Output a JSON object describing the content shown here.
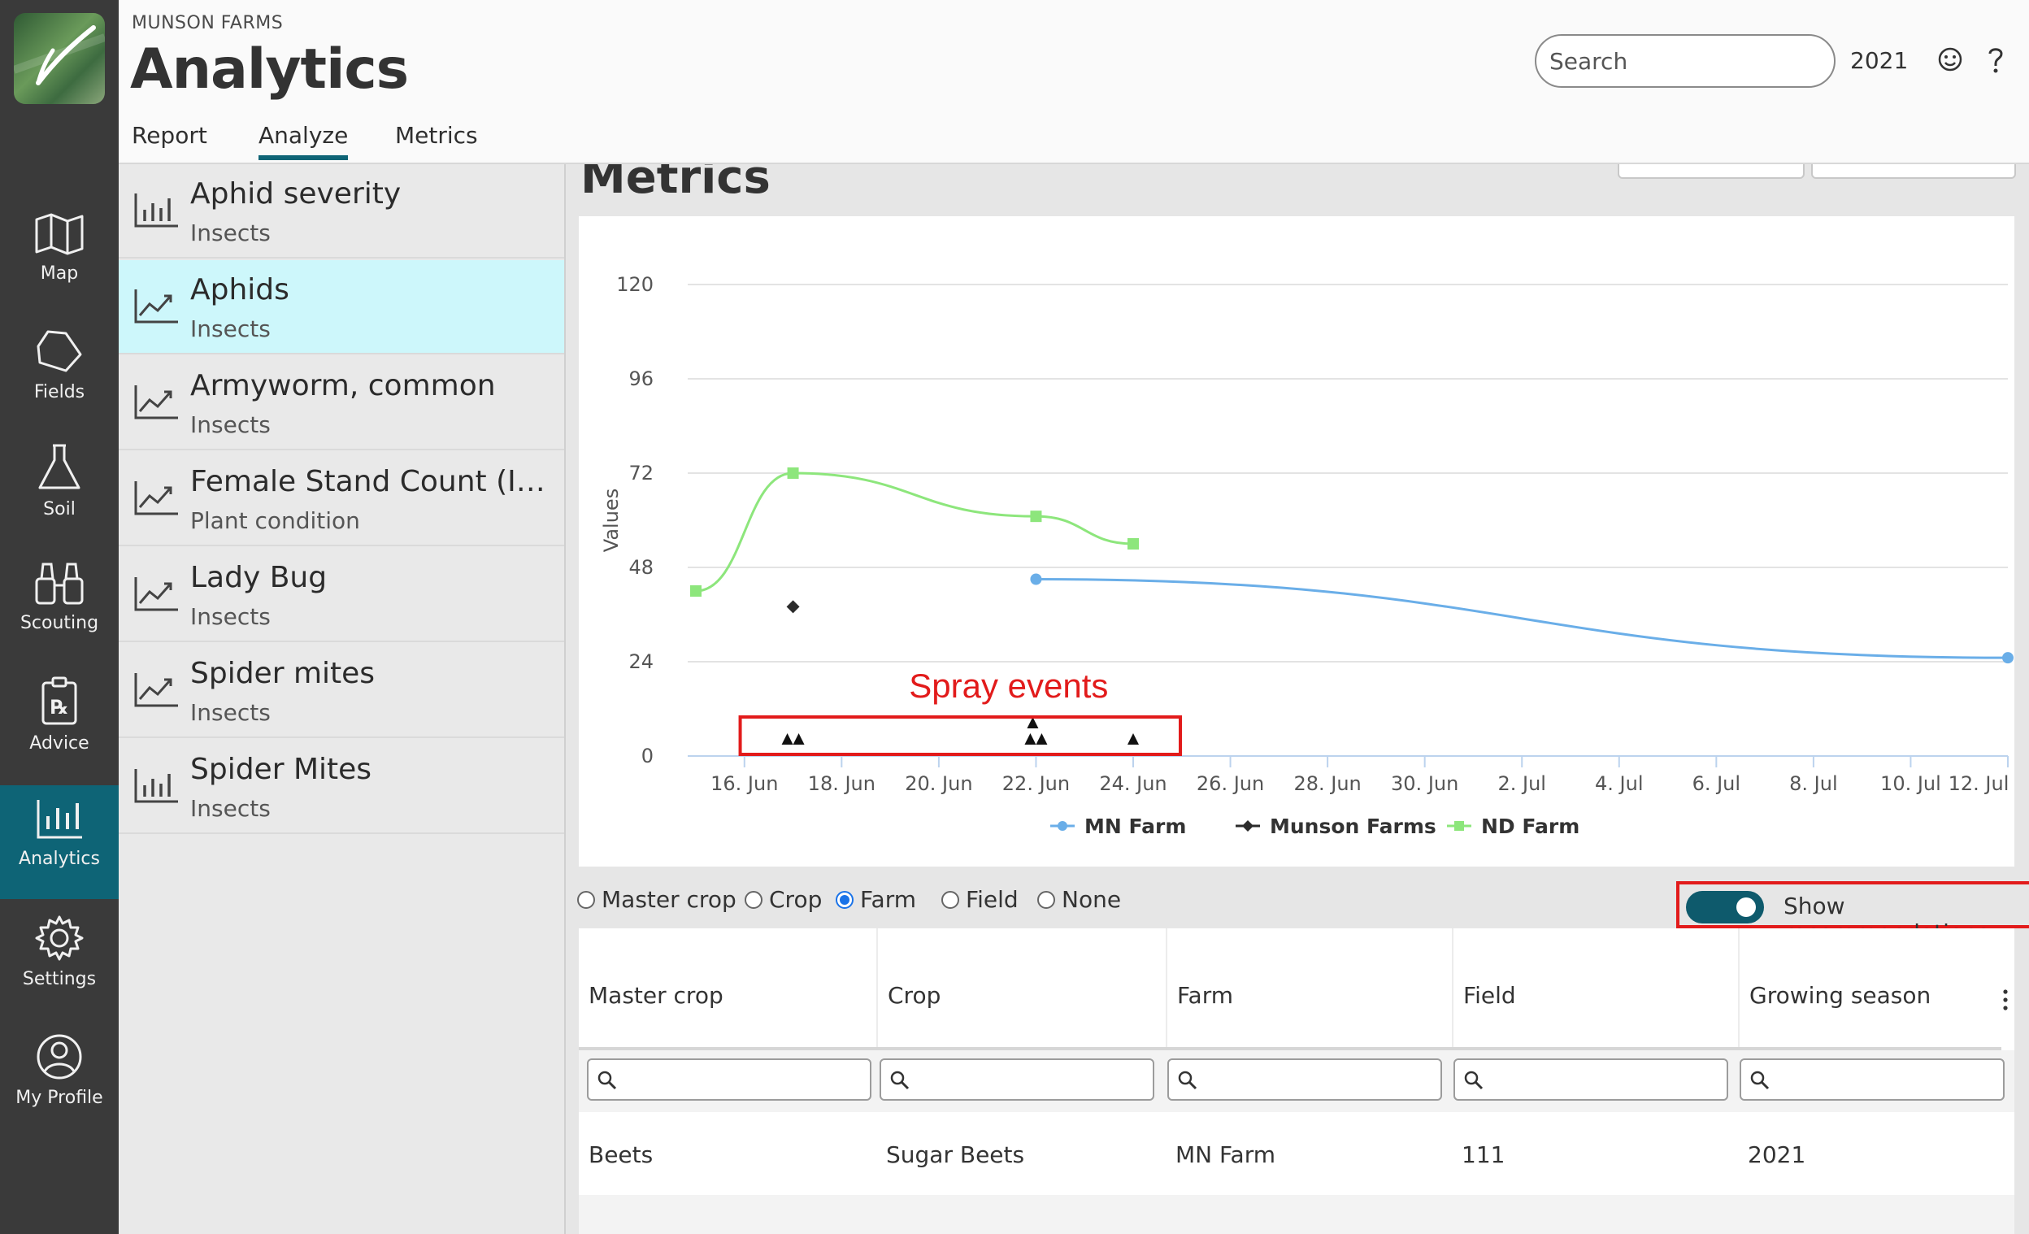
{
  "nav": {
    "items": [
      {
        "label": "Map",
        "icon": "map-icon"
      },
      {
        "label": "Fields",
        "icon": "field-icon"
      },
      {
        "label": "Soil",
        "icon": "flask-icon"
      },
      {
        "label": "Scouting",
        "icon": "binoculars-icon"
      },
      {
        "label": "Advice",
        "icon": "prescription-icon"
      },
      {
        "label": "Analytics",
        "icon": "bar-chart-icon",
        "active": true
      },
      {
        "label": "Settings",
        "icon": "gear-icon"
      },
      {
        "label": "My Profile",
        "icon": "user-icon"
      }
    ]
  },
  "header": {
    "org": "MUNSON FARMS",
    "title": "Analytics",
    "tabs": [
      {
        "label": "Report"
      },
      {
        "label": "Analyze",
        "active": true
      },
      {
        "label": "Metrics"
      }
    ],
    "search_placeholder": "Search",
    "year": "2021"
  },
  "metrics_list": [
    {
      "title": "Aphid severity",
      "category": "Insects",
      "icon": "bar-chart-icon"
    },
    {
      "title": "Aphids",
      "category": "Insects",
      "icon": "line-chart-icon",
      "active": true
    },
    {
      "title": "Armyworm, common",
      "category": "Insects",
      "icon": "line-chart-icon"
    },
    {
      "title": "Female Stand Count (In the field)",
      "category": "Plant condition",
      "icon": "line-chart-icon"
    },
    {
      "title": "Lady Bug",
      "category": "Insects",
      "icon": "line-chart-icon"
    },
    {
      "title": "Spider mites",
      "category": "Insects",
      "icon": "line-chart-icon"
    },
    {
      "title": "Spider Mites",
      "category": "Insects",
      "icon": "bar-chart-icon"
    }
  ],
  "section_title": "Metrics",
  "annotations": {
    "spray_label": "Spray events",
    "spray_color": "#e21b1b"
  },
  "chart_data": {
    "type": "line",
    "ylabel": "Values",
    "ylim": [
      0,
      120
    ],
    "yticks": [
      0,
      24,
      48,
      72,
      96,
      120
    ],
    "xticks": [
      "16. Jun",
      "18. Jun",
      "20. Jun",
      "22. Jun",
      "24. Jun",
      "26. Jun",
      "28. Jun",
      "30. Jun",
      "2. Jul",
      "4. Jul",
      "6. Jul",
      "8. Jul",
      "10. Jul",
      "12. Jul"
    ],
    "grid": true,
    "legend_position": "bottom",
    "series": [
      {
        "name": "MN Farm",
        "color": "#6aaee8",
        "marker": "circle",
        "points": [
          [
            "2021-06-22",
            45
          ],
          [
            "2021-07-12",
            25
          ]
        ]
      },
      {
        "name": "Munson Farms",
        "color": "#2b2b2b",
        "marker": "diamond",
        "points": [
          [
            "2021-06-17",
            38
          ]
        ]
      },
      {
        "name": "ND Farm",
        "color": "#8de67c",
        "marker": "square",
        "points": [
          [
            "2021-06-15",
            42
          ],
          [
            "2021-06-17",
            72
          ],
          [
            "2021-06-22",
            61
          ],
          [
            "2021-06-24",
            54
          ]
        ]
      }
    ],
    "spray_events": [
      "2021-06-17",
      "2021-06-17",
      "2021-06-22",
      "2021-06-22",
      "2021-06-22",
      "2021-06-24"
    ]
  },
  "group_options": {
    "options": [
      "Master crop",
      "Crop",
      "Farm",
      "Field",
      "None"
    ],
    "selected": "Farm",
    "show_recommendations_label": "Show recommendations",
    "show_recommendations_on": true
  },
  "table": {
    "columns": [
      "Master crop",
      "Crop",
      "Farm",
      "Field",
      "Growing season"
    ],
    "rows": [
      [
        "Beets",
        "Sugar Beets",
        "MN Farm",
        "111",
        "2021"
      ]
    ]
  }
}
